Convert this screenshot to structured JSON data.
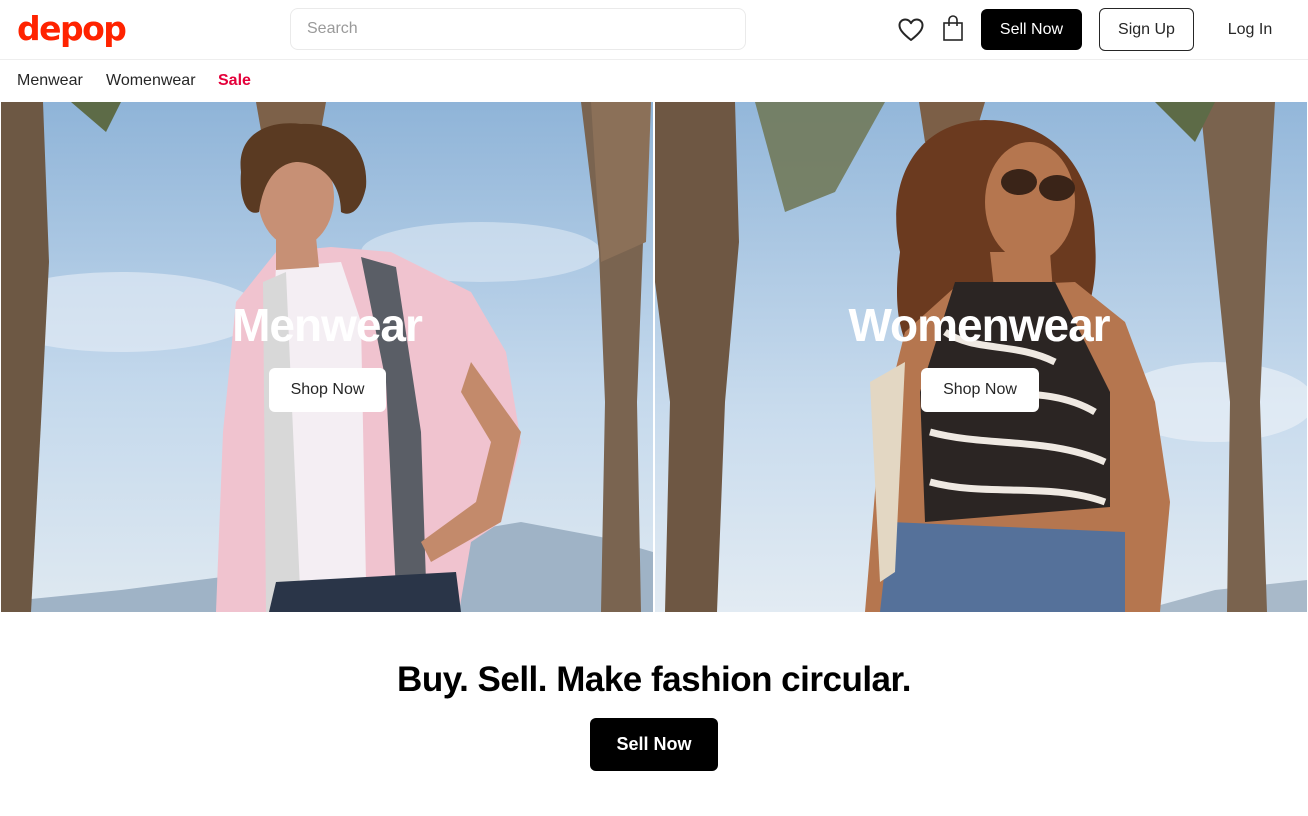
{
  "header": {
    "logo": "depop",
    "search_placeholder": "Search",
    "sell_now_label": "Sell Now",
    "sign_up_label": "Sign Up",
    "log_in_label": "Log In",
    "icons": [
      "heart-icon",
      "shopping-bag-icon"
    ]
  },
  "category_nav": {
    "items": [
      {
        "label": "Menwear"
      },
      {
        "label": "Womenwear"
      },
      {
        "label": "Sale"
      }
    ],
    "sale_color": "#e4003a"
  },
  "hero": {
    "panels": [
      {
        "title": "Menwear",
        "button_label": "Shop Now"
      },
      {
        "title": "Womenwear",
        "button_label": "Shop Now"
      }
    ]
  },
  "promo": {
    "tagline": "Buy. Sell. Make fashion circular.",
    "button_label": "Sell Now"
  },
  "colors": {
    "brand": "#ff2300",
    "primary_button": "#000000",
    "sky": "#a9c6e2"
  }
}
